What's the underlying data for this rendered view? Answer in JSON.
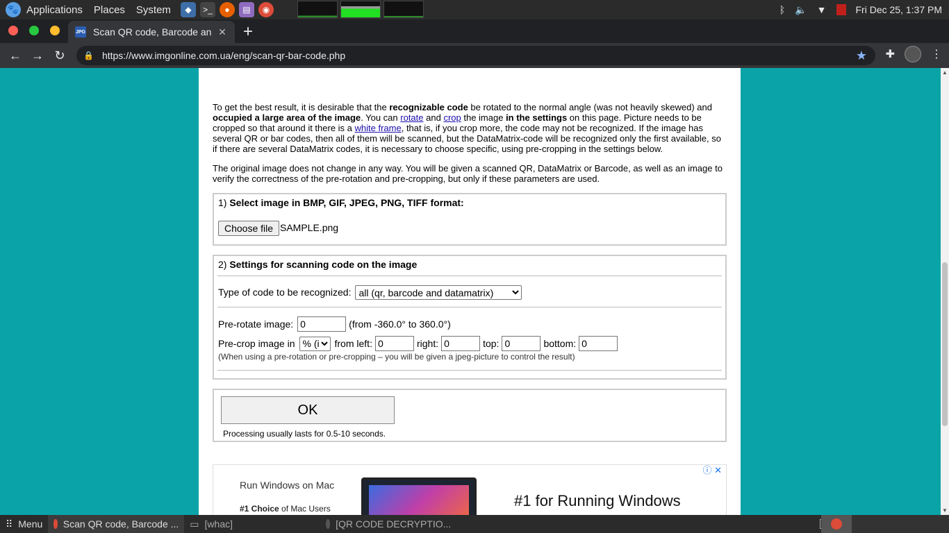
{
  "os_panel": {
    "menu_applications": "Applications",
    "menu_places": "Places",
    "menu_system": "System",
    "clock": "Fri Dec 25,  1:37 PM"
  },
  "browser": {
    "tab_title": "Scan QR code, Barcode an",
    "favicon_text": "JPG",
    "tab_close": "✕",
    "new_tab": "+",
    "url": "https://www.imgonline.com.ua/eng/scan-qr-bar-code.php"
  },
  "page": {
    "para1_a": "To get the best result, it is desirable that the ",
    "para1_b": "recognizable code",
    "para1_c": " be rotated to the normal angle (was not heavily skewed) and ",
    "para1_d": "occupied a large area of the image",
    "para1_e": ". You can ",
    "link_rotate": "rotate",
    "para1_f": " and ",
    "link_crop": "crop",
    "para1_g": " the image ",
    "para1_h": "in the settings",
    "para1_i": " on this page. Picture needs to be cropped so that around it there is a ",
    "link_white_frame": "white frame",
    "para1_j": ", that is, if you crop more, the code may not be recognized. If the image has several QR or bar codes, then all of them will be scanned, but the DataMatrix-code will be recognized only the first available, so if there are several DataMatrix codes, it is necessary to choose specific, using pre-cropping in the settings below.",
    "para2": "The original image does not change in any way. You will be given a scanned QR, DataMatrix or Barcode, as well as an image to verify the correctness of the pre-rotation and pre-cropping, but only if these parameters are used.",
    "step1_num": "1) ",
    "step1_title": "Select image in BMP, GIF, JPEG, PNG, TIFF format:",
    "choose_file": "Choose file",
    "file_name": "SAMPLE.png",
    "step2_num": "2) ",
    "step2_title": "Settings for scanning code on the image",
    "code_type_label": "Type of code to be recognized:",
    "code_type_value": "all (qr, barcode and datamatrix)",
    "prerotate_label": "Pre-rotate image:",
    "prerotate_value": "0",
    "prerotate_range": "(from -360.0° to 360.0°)",
    "precrop_label": "Pre-crop image in",
    "precrop_unit": "% (i",
    "from_left_label": "from left:",
    "from_left_value": "0",
    "right_label": "right:",
    "right_value": "0",
    "top_label": "top:",
    "top_value": "0",
    "bottom_label": "bottom:",
    "bottom_value": "0",
    "hint": "(When using a pre-rotation or pre-cropping – you will be given a jpeg-picture to control the result)",
    "ok": "OK",
    "processing": "Processing usually lasts for 0.5-10 seconds."
  },
  "ad": {
    "title": "Run Windows on Mac",
    "sub_bold": "#1 Choice",
    "sub_rest": " of Mac Users",
    "headline": "#1 for Running Windows",
    "icons": "ⓘ ✕"
  },
  "taskbar": {
    "menu": "Menu",
    "task1": "Scan QR code, Barcode ...",
    "task2": "[whac]",
    "task3": "[QR CODE DECRYPTIO..."
  },
  "colors": {
    "page_bg": "#0aa4a8",
    "link": "#1a0dab"
  }
}
